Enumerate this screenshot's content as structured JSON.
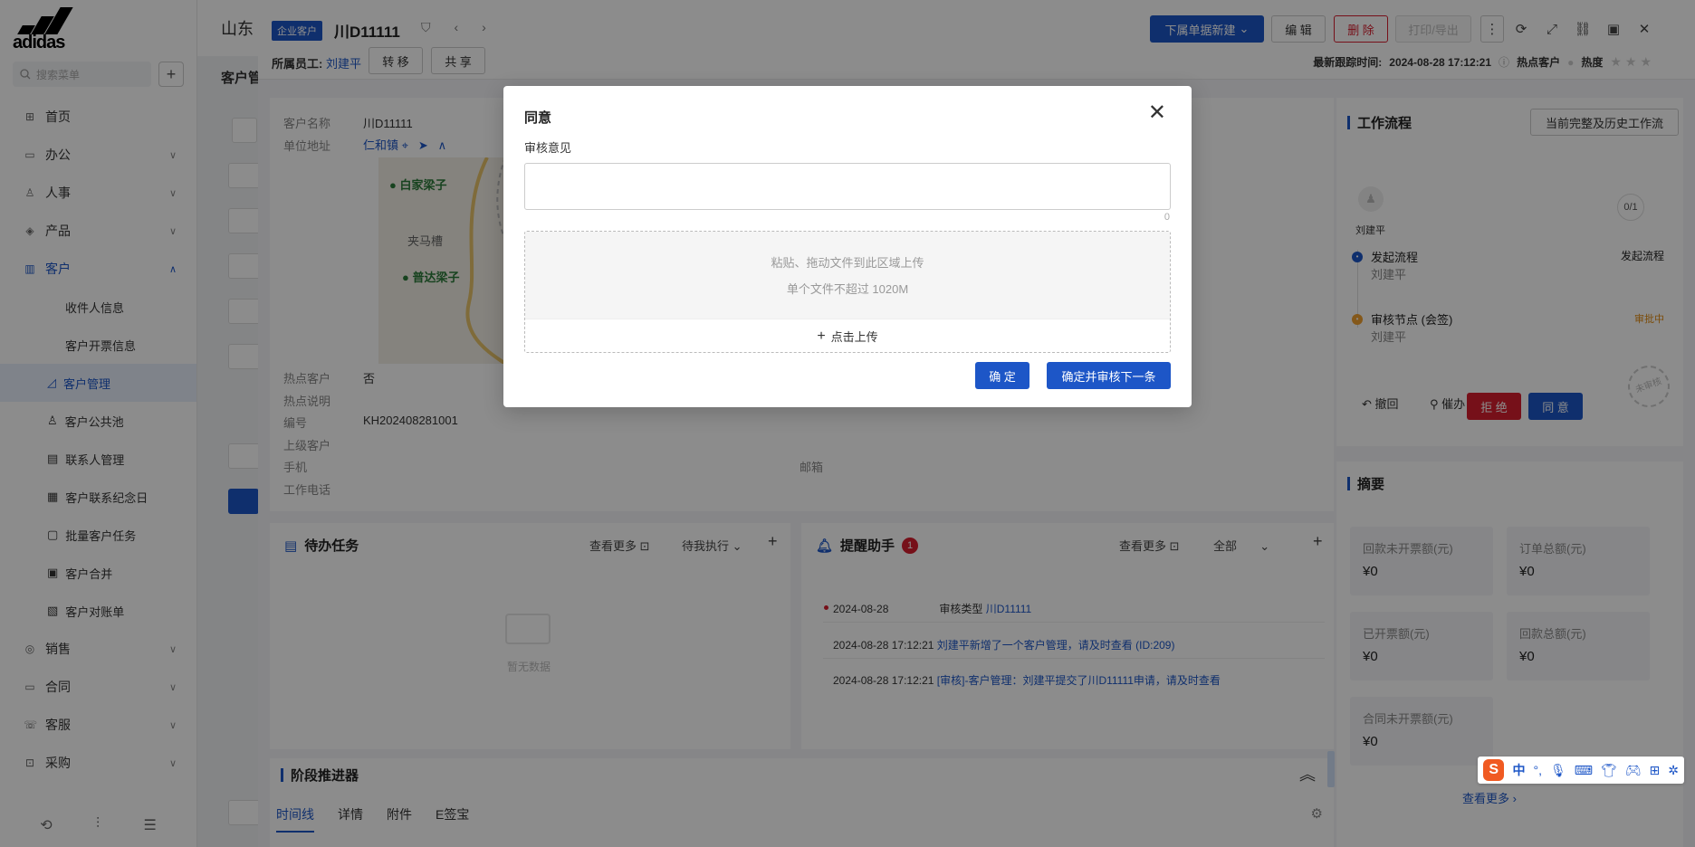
{
  "sidebar": {
    "search_placeholder": "搜索菜单",
    "logo_text": "adidas",
    "menu": [
      {
        "label": "首页",
        "icon": "grid-icon"
      },
      {
        "label": "办公",
        "icon": "briefcase-icon"
      },
      {
        "label": "人事",
        "icon": "person-icon"
      },
      {
        "label": "产品",
        "icon": "cube-icon"
      },
      {
        "label": "客户",
        "icon": "chart-icon"
      }
    ],
    "customer_sub": [
      "收件人信息",
      "客户开票信息",
      "客户管理",
      "客户公共池",
      "联系人管理",
      "客户联系纪念日",
      "批量客户任务",
      "客户合并",
      "客户对账单"
    ],
    "menu_after": [
      {
        "label": "销售",
        "icon": "target-icon"
      },
      {
        "label": "合同",
        "icon": "contract-icon"
      },
      {
        "label": "客服",
        "icon": "service-icon"
      },
      {
        "label": "采购",
        "icon": "cart-icon"
      }
    ]
  },
  "background": {
    "top_text": "山东",
    "sub_title": "客户管"
  },
  "drawer": {
    "tag": "企业客户",
    "title": "川D11111",
    "owner_label": "所属员工:",
    "owner_name": "刘建平",
    "transfer": "转 移",
    "share": "共 享",
    "new_sub": "下属单据新建",
    "edit": "编 辑",
    "delete": "删 除",
    "print": "打印/导出",
    "track_label": "最新跟踪时间:",
    "track_time": "2024-08-28 17:12:21",
    "hot_customer": "热点客户",
    "heat": "热度",
    "info": {
      "name_label": "客户名称",
      "name_value": "川D11111",
      "addr_label": "单位地址",
      "addr_value": "仁和镇",
      "hot_label": "热点客户",
      "hot_value": "否",
      "hot_desc_label": "热点说明",
      "code_label": "编号",
      "code_value": "KH202408281001",
      "parent_label": "上级客户",
      "phone_label": "手机",
      "email_label": "邮箱",
      "work_phone_label": "工作电话"
    },
    "map": {
      "pin1": "白家梁子",
      "place": "夹马槽",
      "pin2": "普达梁子"
    },
    "todo": {
      "title": "待办任务",
      "more": "查看更多",
      "filter": "待我执行",
      "empty": "暂无数据"
    },
    "reminder": {
      "title": "提醒助手",
      "count": "1",
      "more": "查看更多",
      "filter": "全部",
      "items": [
        {
          "time": "2024-08-28",
          "text": "审核类型",
          "link": "川D11111"
        },
        {
          "time": "2024-08-28 17:12:21",
          "text": "",
          "link": "刘建平新增了一个客户管理，请及时查看 (ID:209)"
        },
        {
          "time": "2024-08-28 17:12:21",
          "text": "",
          "link": "[审核]-客户管理：刘建平提交了川D11111申请，请及时查看"
        }
      ]
    },
    "stage": {
      "title": "阶段推进器",
      "tabs": [
        "时间线",
        "详情",
        "附件",
        "E签宝"
      ]
    },
    "workflow": {
      "title": "工作流程",
      "history_btn": "当前完整及历史工作流",
      "user": "刘建平",
      "progress": "0/1",
      "steps": [
        {
          "name": "发起流程",
          "user": "刘建平",
          "status": "发起流程"
        },
        {
          "name": "审核节点 (会签)",
          "user": "刘建平",
          "status": "审批中"
        }
      ],
      "stamp": "未审核",
      "withdraw": "撤回",
      "urge": "催办",
      "reject": "拒 绝",
      "approve": "同 意"
    },
    "summary": {
      "title": "摘要",
      "cards": [
        {
          "label": "回款未开票额(元)",
          "value": "¥0"
        },
        {
          "label": "订单总额(元)",
          "value": "¥0"
        },
        {
          "label": "已开票额(元)",
          "value": "¥0"
        },
        {
          "label": "回款总额(元)",
          "value": "¥0"
        },
        {
          "label": "合同未开票额(元)",
          "value": "¥0"
        }
      ],
      "more": "查看更多"
    }
  },
  "modal": {
    "title": "同意",
    "opinion_label": "审核意见",
    "count": "0",
    "upload_line1": "粘贴、拖动文件到此区域上传",
    "upload_line2": "单个文件不超过 1020M",
    "upload_click": "点击上传",
    "confirm": "确 定",
    "confirm_next": "确定并审核下一条"
  },
  "ime": {
    "logo": "S",
    "lang": "中"
  }
}
